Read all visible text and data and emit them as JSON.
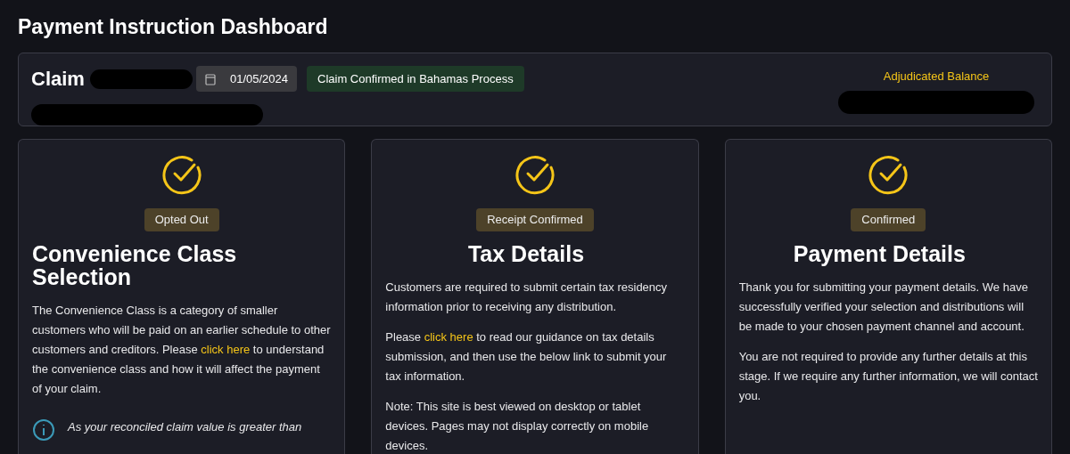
{
  "page_title": "Payment Instruction Dashboard",
  "claim": {
    "title": "Claim",
    "date": "01/05/2024",
    "status": "Claim Confirmed in Bahamas Process",
    "balance_label": "Adjudicated Balance"
  },
  "cards": [
    {
      "status": "Opted Out",
      "title": "Convenience Class Selection",
      "kind": "left_title",
      "paragraphs": [
        [
          {
            "text": "The Convenience Class is a category of smaller customers who will be paid on an earlier schedule to other customers and creditors. Please "
          },
          {
            "text": "click here",
            "link": true
          },
          {
            "text": " to understand the convenience class and how it will affect the payment of your claim."
          }
        ]
      ],
      "note": "As your reconciled claim value is greater than"
    },
    {
      "status": "Receipt Confirmed",
      "title": "Tax Details",
      "kind": "centered_title",
      "paragraphs": [
        [
          {
            "text": "Customers are required to submit certain tax residency information prior to receiving any distribution."
          }
        ],
        [
          {
            "text": "Please "
          },
          {
            "text": "click here",
            "link": true
          },
          {
            "text": " to read our guidance on tax details submission, and then use the below link to submit your tax information."
          }
        ],
        [
          {
            "text": "Note: This site is best viewed on desktop or tablet devices. Pages may not display correctly on mobile devices."
          }
        ]
      ]
    },
    {
      "status": "Confirmed",
      "title": "Payment Details",
      "kind": "centered_title",
      "paragraphs": [
        [
          {
            "text": "Thank you for submitting your payment details. We have successfully verified your selection and distributions will be made to your chosen payment channel and account."
          }
        ],
        [
          {
            "text": "You are not required to provide any further details at this stage. If we require any further information, we will contact you."
          }
        ]
      ]
    }
  ]
}
